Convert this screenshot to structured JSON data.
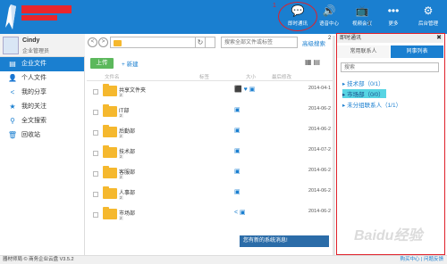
{
  "header": {
    "toolbar": [
      {
        "id": "chat",
        "label": "即时通讯",
        "icon": "chat-icon",
        "glyph": "💬"
      },
      {
        "id": "voice",
        "label": "语音中心",
        "icon": "speaker-icon",
        "glyph": "🔊"
      },
      {
        "id": "video",
        "label": "视频会议",
        "icon": "video-icon",
        "glyph": "📺"
      },
      {
        "id": "more",
        "label": "更多",
        "icon": "more-icon",
        "glyph": "•••"
      },
      {
        "id": "admin",
        "label": "后台管理",
        "icon": "gear-icon",
        "glyph": "⚙"
      }
    ],
    "marker1": "1"
  },
  "user": {
    "name": "Cindy",
    "role": "企业管理员"
  },
  "sidebar": {
    "items": [
      {
        "label": "企业文件",
        "icon": "folder-icon",
        "glyph": "▤"
      },
      {
        "label": "个人文件",
        "icon": "person-icon",
        "glyph": "👤"
      },
      {
        "label": "我的分享",
        "icon": "share-icon",
        "glyph": "<"
      },
      {
        "label": "我的关注",
        "icon": "star-icon",
        "glyph": "★"
      },
      {
        "label": "全文搜索",
        "icon": "search-icon",
        "glyph": "⚲"
      },
      {
        "label": "回收站",
        "icon": "trash-icon",
        "glyph": "🗑"
      }
    ]
  },
  "toolbar": {
    "back": "<",
    "forward": ">",
    "refresh": "↻",
    "search_placeholder": "搜索全部文件或标签",
    "adv_search": "高级搜索",
    "marker2": "2",
    "upload": "上传",
    "new": "+ 新建",
    "view_icons": "▦▤"
  },
  "table": {
    "headers": [
      "文件名",
      "标签",
      "大小",
      "最后修改"
    ],
    "rows": [
      {
        "name": "共享文件夹",
        "badge": "2",
        "actions": "⬛ ♥ ▣",
        "date": "2014-04-1"
      },
      {
        "name": "IT部",
        "badge": "2",
        "actions": "▣",
        "date": "2014-06-2"
      },
      {
        "name": "后勤部",
        "badge": "2",
        "actions": "▣",
        "date": "2014-06-2"
      },
      {
        "name": "技术部",
        "badge": "2",
        "actions": "▣",
        "date": "2014-07-2"
      },
      {
        "name": "客服部",
        "badge": "2",
        "actions": "▣",
        "date": "2014-06-2"
      },
      {
        "name": "人事部",
        "badge": "2",
        "actions": "▣",
        "date": "2014-06-2"
      },
      {
        "name": "市场部",
        "badge": "2",
        "actions": "< ▣",
        "date": "2014-06-2"
      }
    ],
    "notice": "您有新的系统消息!"
  },
  "chat": {
    "title": "即时通讯",
    "close": "✖",
    "tabs": [
      "常用联系人",
      "同事列表"
    ],
    "search_placeholder": "搜索",
    "marker3": "3",
    "departments": [
      {
        "label": "▸ 技术部（0/1）",
        "highlight": false
      },
      {
        "label": "▸ 市场部（0/0）",
        "highlight": true
      },
      {
        "label": "▸ 未分组联系人（1/1）",
        "highlight": false
      }
    ]
  },
  "status": {
    "left": "器材师局 © 商务企业云盘 V3.5.2",
    "right": "购买中心 | 问题反馈"
  },
  "watermark": "Baidu经验",
  "colors": {
    "primary": "#1a7fd0",
    "highlight": "#57d4e3",
    "annotation": "#e0202a",
    "folder": "#f5b82e"
  }
}
